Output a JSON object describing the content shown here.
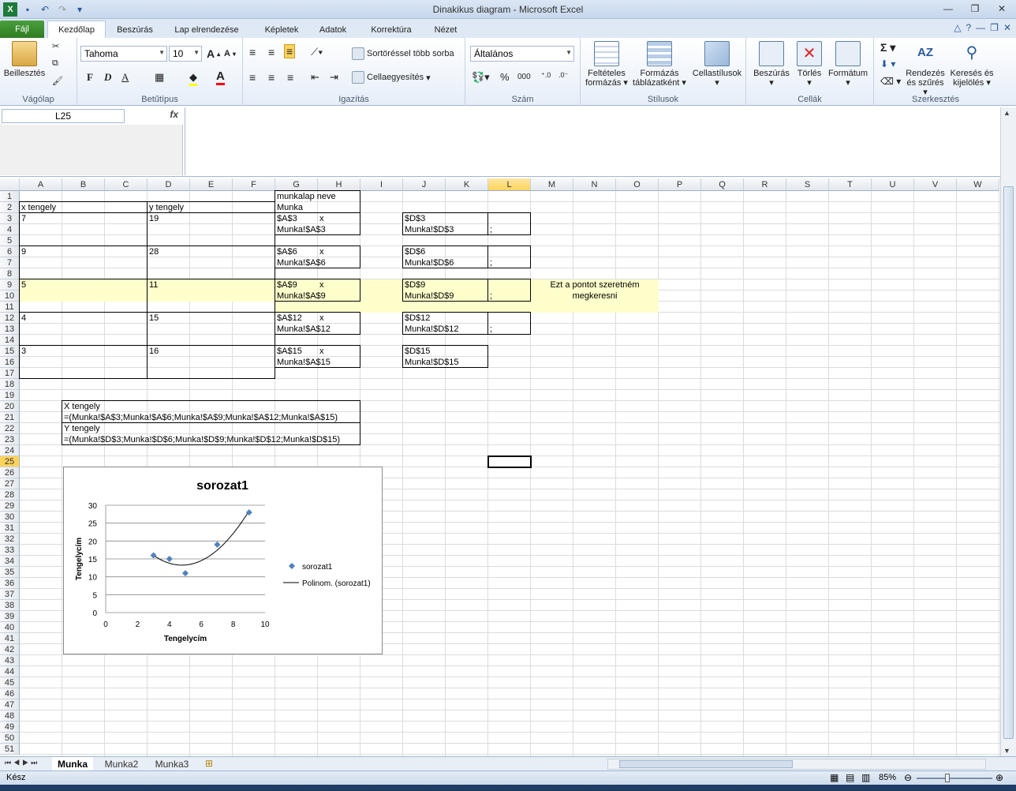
{
  "window": {
    "title": "Dinakikus diagram  -  Microsoft Excel"
  },
  "tabs": {
    "file": "Fájl",
    "items": [
      "Kezdőlap",
      "Beszúrás",
      "Lap elrendezése",
      "Képletek",
      "Adatok",
      "Korrektúra",
      "Nézet"
    ],
    "active": "Kezdőlap"
  },
  "ribbon": {
    "clipboard": {
      "label": "Vágólap",
      "paste": "Beillesztés"
    },
    "font": {
      "label": "Betűtípus",
      "name": "Tahoma",
      "size": "10",
      "bold": "F",
      "italic": "D",
      "underline": "A"
    },
    "alignment": {
      "label": "Igazítás",
      "wrap": "Sortöréssel több sorba",
      "merge": "Cellaegyesítés"
    },
    "number": {
      "label": "Szám",
      "format": "Általános",
      "percent": "%",
      "thousands": "000"
    },
    "styles": {
      "label": "Stílusok",
      "conditional": "Feltételes formázás",
      "table": "Formázás táblázatként",
      "cell": "Cellastílusok"
    },
    "cells": {
      "label": "Cellák",
      "insert": "Beszúrás",
      "delete": "Törlés",
      "format": "Formátum"
    },
    "editing": {
      "label": "Szerkesztés",
      "sort": "Rendezés és szűrés",
      "find": "Keresés és kijelölés"
    }
  },
  "formula_bar": {
    "name_box": "L25",
    "fx": "fx",
    "content": ""
  },
  "columns": [
    "A",
    "B",
    "C",
    "D",
    "E",
    "F",
    "G",
    "H",
    "I",
    "J",
    "K",
    "L",
    "M",
    "N",
    "O",
    "P",
    "Q",
    "R",
    "S",
    "T",
    "U",
    "V",
    "W"
  ],
  "selected_column": "L",
  "selected_row": "25",
  "cells": {
    "G1": "munkalap neve",
    "G2": "Munka",
    "A2": "x tengely",
    "D2": "y tengely",
    "A3": "7",
    "D3": "19",
    "G3": "$A$3",
    "H3": "x",
    "G4": "Munka!$A$3",
    "J3": "$D$3",
    "J4": "Munka!$D$3",
    "L4": ";",
    "A6": "9",
    "D6": "28",
    "G6": "$A$6",
    "H6": "x",
    "G7": "Munka!$A$6",
    "J6": "$D$6",
    "J7": "Munka!$D$6",
    "L7": ";",
    "A9": "5",
    "D9": "11",
    "G9": "$A$9",
    "H9": "x",
    "G10": "Munka!$A$9",
    "J9": "$D$9",
    "J10": "Munka!$D$9",
    "L10": ";",
    "M9": "Ezt a pontot szeretném",
    "M10": "megkeresni",
    "A12": "4",
    "D12": "15",
    "G12": "$A$12",
    "H12": "x",
    "G13": "Munka!$A$12",
    "J12": "$D$12",
    "J13": "Munka!$D$12",
    "L13": ";",
    "A15": "3",
    "D15": "16",
    "G15": "$A$15",
    "H15": "x",
    "G16": "Munka!$A$15",
    "J15": "$D$15",
    "J16": "Munka!$D$15",
    "B20": "X tengely",
    "B21": "=(Munka!$A$3;Munka!$A$6;Munka!$A$9;Munka!$A$12;Munka!$A$15)",
    "B22": "Y tengely",
    "B23": "=(Munka!$D$3;Munka!$D$6;Munka!$D$9;Munka!$D$12;Munka!$D$15)"
  },
  "chart_data": {
    "type": "scatter",
    "title": "sorozat1",
    "xlabel": "Tengelycím",
    "ylabel": "Tengelycím",
    "xlim": [
      0,
      10
    ],
    "ylim": [
      0,
      30
    ],
    "x_ticks": [
      0,
      2,
      4,
      6,
      8,
      10
    ],
    "y_ticks": [
      0,
      5,
      10,
      15,
      20,
      25,
      30
    ],
    "series": [
      {
        "name": "sorozat1",
        "x": [
          7,
          9,
          5,
          4,
          3
        ],
        "y": [
          19,
          28,
          11,
          15,
          16
        ],
        "color": "#4f81bd"
      }
    ],
    "trendline": {
      "name": "Polinom. (sorozat1)",
      "type": "polynomial"
    },
    "grid": "horizontal",
    "legend": "right"
  },
  "sheets": [
    "Munka",
    "Munka2",
    "Munka3"
  ],
  "active_sheet": "Munka",
  "status": {
    "ready": "Kész",
    "zoom": "85%"
  }
}
